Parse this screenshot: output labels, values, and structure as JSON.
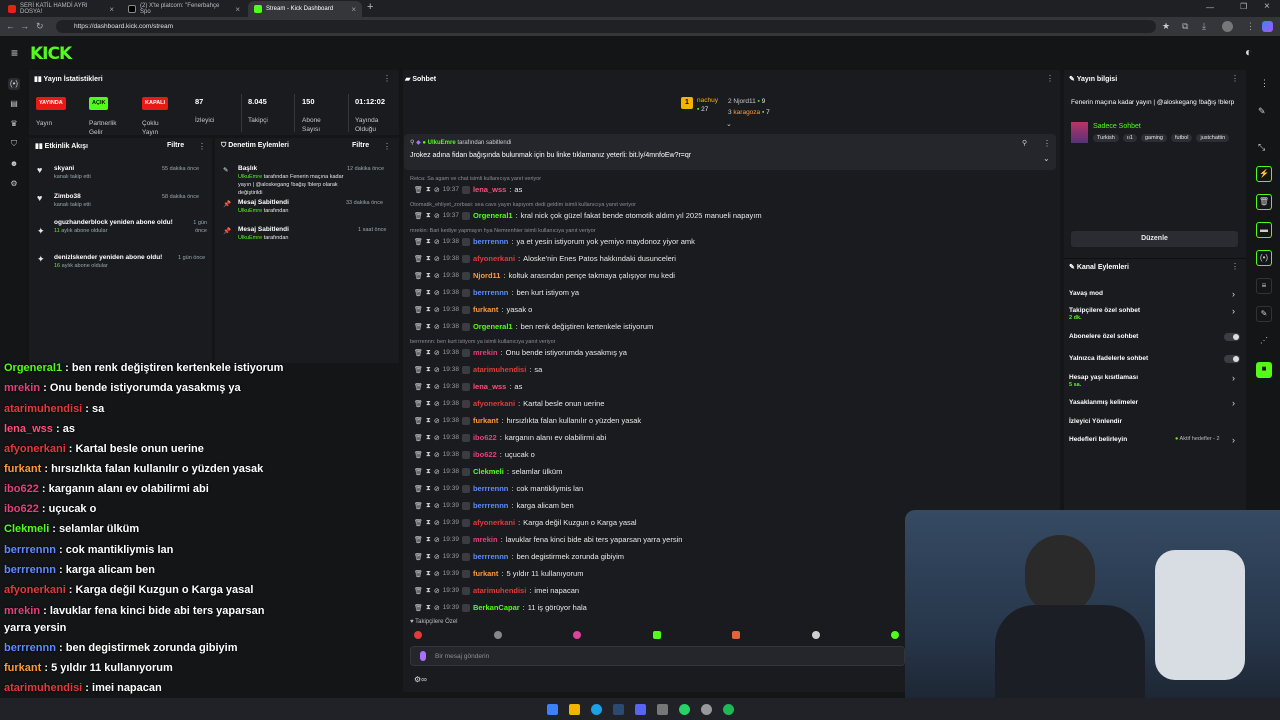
{
  "browser": {
    "tabs": [
      {
        "label": "SERİ KATİL HAMDİ AYRI DOSYA!",
        "color": "#e62117"
      },
      {
        "label": "(2) X'te platcom: \"Fenerbahçe Spo",
        "color": "#ffffff"
      },
      {
        "label": "Stream - Kick Dashboard",
        "color": "#53fc18"
      }
    ],
    "url": "https://dashboard.kick.com/stream"
  },
  "logo": "KICK",
  "stats": {
    "title": "Yayın İstatistikleri",
    "items": [
      {
        "badge": "YAYINDA",
        "badge_color": "#e91916",
        "label": "Yayın"
      },
      {
        "badge": "AÇIK",
        "badge_color": "#53fc18",
        "label": "Partnerlik Gelir"
      },
      {
        "badge": "KAPALI",
        "badge_color": "#e91916",
        "label": "Çoklu Yayın"
      },
      {
        "value": "87",
        "label": "İzleyici"
      },
      {
        "value": "8.045",
        "label": "Takipçi"
      },
      {
        "value": "150",
        "label": "Abone Sayısı"
      },
      {
        "value": "01:12:02",
        "label": "Yayında Olduğu"
      }
    ]
  },
  "activity": {
    "title": "Etkinlik Akışı",
    "filter": "Filtre",
    "items": [
      {
        "name": "skyani",
        "desc": "kanalı takip etti",
        "time": "55 dakika önce"
      },
      {
        "name": "Zimbo38",
        "desc": "kanalı takip etti",
        "time": "58 dakika önce"
      },
      {
        "name": "oguzhanderblock yeniden abone oldu!",
        "desc_green": "11",
        "desc": " aylık abone oldular",
        "time": "1 gün önce"
      },
      {
        "name": "denizIskender yeniden abone oldu!",
        "desc_green": "16",
        "desc": " aylık abone oldular",
        "time": "1 gün önce"
      }
    ]
  },
  "mod": {
    "title": "Denetim Eylemleri",
    "filter": "Filtre",
    "items": [
      {
        "title": "Başlık",
        "user": "UlkuEmre",
        "line": "tarafından Fenerin maçına kadar yayın | @aloskegang !bağış !blerp olarak değiştirildi",
        "time": "12 dakika önce"
      },
      {
        "title": "Mesaj Sabitlendi",
        "user": "UlkuEmre",
        "line": "tarafından",
        "time": "33 dakika önce"
      },
      {
        "title": "Mesaj Sabitlendi",
        "user": "UlkuEmre",
        "line": "tarafından",
        "time": "1 saat önce"
      }
    ]
  },
  "chat": {
    "title": "Sohbet",
    "top": [
      {
        "name": "nachuy",
        "n": "27"
      },
      {
        "name": "Njord11",
        "n": "9"
      },
      {
        "name": "karagoza",
        "n": "7"
      }
    ],
    "pinned_by": "UlkuEmre",
    "pinned_by_suffix": "tarafından sabitlendi",
    "pinned": "Jrokez adına fidan bağışında bulunmak için bu linke tıklamanız yeterli: bit.ly/4mnfoEw?r=qr",
    "messages": [
      {
        "reply": "Reica: Sa agam ve chat isimli kullanıcıya yanıt veriyor",
        "time": "19:37",
        "user": "lena_wss",
        "color": "#ff4f7b",
        "text": "as"
      },
      {
        "reply": "Otomatik_ehliyet_zorbasi: sea cavs yayın kapıyom dedi geldim isimli kullanıcıya yanıt veriyor",
        "time": "19:37",
        "user": "Orgeneral1",
        "color": "#53fc18",
        "text": "kral nick çok güzel fakat bende otomotik aldım yıl 2025 manueli napayım"
      },
      {
        "reply": "mrekin: Bari kediye yapmayın hya Nemrenhier isimli kullanıcıya yanıt veriyor",
        "time": "19:38",
        "user": "berrrennn",
        "color": "#5e8bff",
        "text": "ya et yesin istiyorum yok yemiyo maydonoz yiyor amk"
      },
      {
        "time": "19:38",
        "user": "afyonerkani",
        "color": "#e23a3a",
        "text": "Aloske'nin Enes Patos hakkındaki dusunceleri"
      },
      {
        "time": "19:38",
        "user": "Njord11",
        "color": "#ff9b3b",
        "text": "koltuk arasından pençe takmaya çalışıyor mu kedi"
      },
      {
        "time": "19:38",
        "user": "berrrennn",
        "color": "#5e8bff",
        "text": "ben kurt istiyom ya"
      },
      {
        "time": "19:38",
        "user": "furkant",
        "color": "#ff9b3b",
        "text": "yasak o"
      },
      {
        "time": "19:38",
        "user": "Orgeneral1",
        "color": "#53fc18",
        "text": "ben renk değiştiren kertenkele istiyorum"
      },
      {
        "reply": "berrrennn: ben kurt istiyom ya isimli kullanıcıya yanıt veriyor",
        "time": "19:38",
        "user": "mrekin",
        "color": "#e2417a",
        "text": "Onu bende istiyorumda yasakmış ya"
      },
      {
        "time": "19:38",
        "user": "atarimuhendisi",
        "color": "#e23a3a",
        "text": "sa"
      },
      {
        "time": "19:38",
        "user": "lena_wss",
        "color": "#ff4f7b",
        "text": "as"
      },
      {
        "time": "19:38",
        "user": "afyonerkani",
        "color": "#e23a3a",
        "text": "Kartal besle onun uerine"
      },
      {
        "time": "19:38",
        "user": "furkant",
        "color": "#ff9b3b",
        "text": "hırsızlıkta falan kullanılır o yüzden yasak"
      },
      {
        "time": "19:38",
        "user": "ibo622",
        "color": "#e2417a",
        "text": "karganın alanı ev olabilirmi abi"
      },
      {
        "time": "19:38",
        "user": "ibo622",
        "color": "#e2417a",
        "text": "uçucak o"
      },
      {
        "time": "19:38",
        "user": "Clekmeli",
        "color": "#53fc18",
        "text": "selamlar ülküm"
      },
      {
        "time": "19:39",
        "user": "berrrennn",
        "color": "#5e8bff",
        "text": "cok mantikliymis lan"
      },
      {
        "time": "19:39",
        "user": "berrrennn",
        "color": "#5e8bff",
        "text": "karga alicam ben"
      },
      {
        "time": "19:39",
        "user": "afyonerkani",
        "color": "#e23a3a",
        "text": "Karga değil Kuzgun o Karga yasal"
      },
      {
        "time": "19:39",
        "user": "mrekin",
        "color": "#e2417a",
        "text": "lavuklar fena kinci bide abi ters yaparsan yarra yersin"
      },
      {
        "time": "19:39",
        "user": "berrrennn",
        "color": "#5e8bff",
        "text": "ben degistirmek zorunda gibiyim"
      },
      {
        "time": "19:39",
        "user": "furkant",
        "color": "#ff9b3b",
        "text": "5 yıldır 11 kullanıyorum"
      },
      {
        "time": "19:39",
        "user": "atarimuhendisi",
        "color": "#e23a3a",
        "text": "imei napacan"
      },
      {
        "time": "19:39",
        "user": "BerkanCapar",
        "color": "#53fc18",
        "text": "11 iş görüyor hala"
      }
    ],
    "followers_only": "Takipçilere Özel",
    "input_placeholder": "Bir mesaj gönderin"
  },
  "overlay": [
    {
      "user": "Orgeneral1",
      "color": "#53fc18",
      "text": "ben renk değiştiren kertenkele istiyorum"
    },
    {
      "user": "mrekin",
      "color": "#e2417a",
      "text": "Onu bende istiyorumda yasakmış ya"
    },
    {
      "user": "atarimuhendisi",
      "color": "#e23a3a",
      "text": "sa"
    },
    {
      "user": "lena_wss",
      "color": "#ff4f7b",
      "text": "as"
    },
    {
      "user": "afyonerkani",
      "color": "#e23a3a",
      "text": "Kartal besle onun uerine"
    },
    {
      "user": "furkant",
      "color": "#ff9b3b",
      "text": "hırsızlıkta falan kullanılır o yüzden yasak"
    },
    {
      "user": "ibo622",
      "color": "#e2417a",
      "text": "karganın alanı ev olabilirmi abi"
    },
    {
      "user": "ibo622",
      "color": "#e2417a",
      "text": "uçucak o"
    },
    {
      "user": "Clekmeli",
      "color": "#53fc18",
      "text": "selamlar ülküm"
    },
    {
      "user": "berrrennn",
      "color": "#5e8bff",
      "text": "cok mantikliymis lan"
    },
    {
      "user": "berrrennn",
      "color": "#5e8bff",
      "text": "karga alicam ben"
    },
    {
      "user": "afyonerkani",
      "color": "#e23a3a",
      "text": "Karga değil Kuzgun o Karga yasal"
    },
    {
      "user": "mrekin",
      "color": "#e2417a",
      "text": "lavuklar fena kinci bide abi ters yaparsan"
    },
    {
      "user": "",
      "color": "#ffffff",
      "text": "yarra yersin"
    },
    {
      "user": "berrrennn",
      "color": "#5e8bff",
      "text": "ben degistirmek zorunda gibiyim"
    },
    {
      "user": "furkant",
      "color": "#ff9b3b",
      "text": "5 yıldır 11 kullanıyorum"
    },
    {
      "user": "atarimuhendisi",
      "color": "#e23a3a",
      "text": "imei napacan"
    },
    {
      "user": "BerkanCapar",
      "color": "#53fc18",
      "text": "11 iş görüyor hala"
    }
  ],
  "stream_info": {
    "title": "Yayın bilgisi",
    "stream_title": "Fenerin maçına kadar yayın | @aloskegang !bağış !blerp",
    "category": "Sadece Sohbet",
    "tags": [
      "Turkish",
      "ıı1",
      "gaming",
      "futbol",
      "justchattin"
    ],
    "edit": "Düzenle"
  },
  "channel": {
    "title": "Kanal Eylemleri",
    "items": [
      {
        "label": "Yavaş mod",
        "type": "chevron"
      },
      {
        "label": "Takipçilere özel sohbet",
        "sub": "2 dk.",
        "type": "chevron"
      },
      {
        "label": "Abonelere özel sohbet",
        "type": "toggle"
      },
      {
        "label": "Yalnızca ifadelerle sohbet",
        "type": "toggle"
      },
      {
        "label": "Hesap yaşı kısıtlaması",
        "sub": "5 sa.",
        "type": "chevron"
      },
      {
        "label": "Yasaklanmış kelimeler",
        "type": "chevron"
      },
      {
        "label": "İzleyici Yönlendir",
        "type": "none"
      },
      {
        "label": "Hedefleri belirleyin",
        "extra": "Aktif hedefler - 2",
        "type": "chevron"
      }
    ]
  }
}
